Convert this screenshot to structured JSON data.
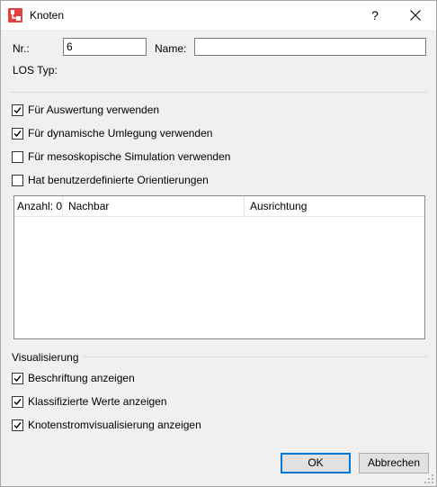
{
  "window": {
    "title": "Knoten",
    "help_label": "?"
  },
  "fields": {
    "nr_label": "Nr.:",
    "nr_value": "6",
    "name_label": "Name:",
    "name_value": "",
    "los_label": "LOS Typ:"
  },
  "options": [
    {
      "label": "Für Auswertung verwenden",
      "checked": true
    },
    {
      "label": "Für dynamische Umlegung verwenden",
      "checked": true
    },
    {
      "label": "Für mesoskopische Simulation verwenden",
      "checked": false
    },
    {
      "label": "Hat benutzerdefinierte Orientierungen",
      "checked": false
    }
  ],
  "table": {
    "columns": [
      "Anzahl: 0",
      "Nachbar",
      "Ausrichtung"
    ],
    "rows": []
  },
  "visualisierung": {
    "group_label": "Visualisierung",
    "options": [
      {
        "label": "Beschriftung anzeigen",
        "checked": true
      },
      {
        "label": "Klassifizierte Werte anzeigen",
        "checked": true
      },
      {
        "label": "Knotenstromvisualisierung anzeigen",
        "checked": true
      }
    ]
  },
  "buttons": {
    "ok": "OK",
    "cancel": "Abbrechen"
  },
  "colors": {
    "accent": "#0078d7",
    "app_icon": "#e04040"
  }
}
